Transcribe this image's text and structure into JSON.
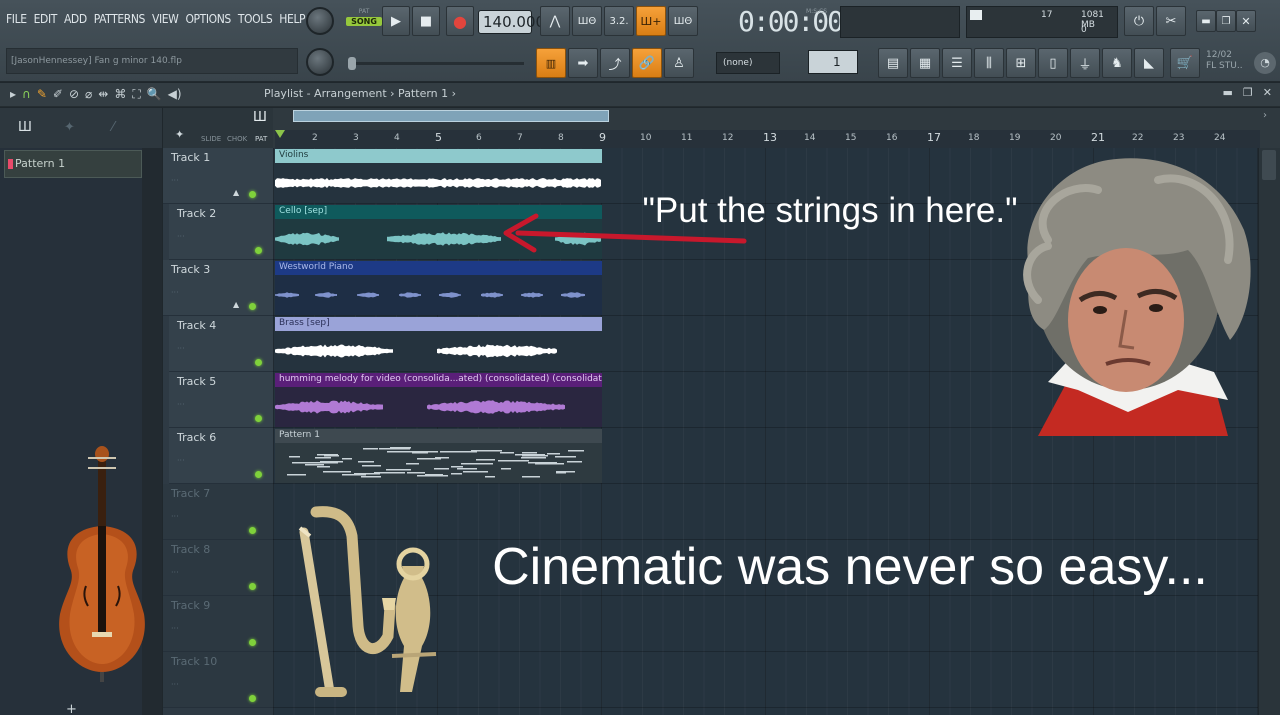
{
  "menu": [
    "FILE",
    "EDIT",
    "ADD",
    "PATTERNS",
    "VIEW",
    "OPTIONS",
    "TOOLS",
    "HELP"
  ],
  "transport": {
    "mode_label_pat": "PAT",
    "mode_label_song": "SONG",
    "tempo": "140.000",
    "time": "0:00:00",
    "time_unit": "M:S:CS"
  },
  "monitor": {
    "cpu_value": "17",
    "memory": "1081 MB",
    "polyphony": "0"
  },
  "project": {
    "filename": "[JasonHennessey] Fan g minor 140.flp"
  },
  "pattern_selector": {
    "value": "(none)",
    "step": "1"
  },
  "fl_news": {
    "date": "12/02",
    "label": "FL STU.."
  },
  "browser_bar": {
    "breadcrumb": "Playlist - Arrangement › Pattern 1 ›"
  },
  "picker": {
    "patterns": [
      "Pattern 1"
    ]
  },
  "ruler": {
    "bars": [
      "2",
      "3",
      "4",
      "5",
      "6",
      "7",
      "8",
      "9",
      "10",
      "11",
      "12",
      "13",
      "14",
      "15",
      "16",
      "17",
      "18",
      "19",
      "20",
      "21",
      "22",
      "23",
      "24"
    ],
    "major_bars": [
      "5",
      "9",
      "13",
      "17",
      "21"
    ]
  },
  "track_tools": {
    "labels": [
      "SLIDE",
      "CHOK",
      "PAT"
    ]
  },
  "tracks": [
    {
      "name": "Track 1"
    },
    {
      "name": "Track 2"
    },
    {
      "name": "Track 3"
    },
    {
      "name": "Track 4"
    },
    {
      "name": "Track 5"
    },
    {
      "name": "Track 6"
    },
    {
      "name": "Track 7"
    },
    {
      "name": "Track 8"
    },
    {
      "name": "Track 9"
    },
    {
      "name": "Track 10"
    }
  ],
  "clips": [
    {
      "label": "Violins",
      "header_color": "#8ec9cc",
      "body_color": "#25333e",
      "wave_color": "#ffffff",
      "text_color": "#1f3b3d"
    },
    {
      "label": "Cello [sep]",
      "header_color": "#0f5a5c",
      "body_color": "#1f3a40",
      "wave_color": "#7bc4c4",
      "text_color": "#9fe1e0"
    },
    {
      "label": "Westworld Piano",
      "header_color": "#1d3a86",
      "body_color": "#1e2e45",
      "wave_color": "#7f92cc",
      "text_color": "#a9b8e8"
    },
    {
      "label": "Brass [sep]",
      "header_color": "#9aa3d8",
      "body_color": "#25333e",
      "wave_color": "#ffffff",
      "text_color": "#2b3058"
    },
    {
      "label": "humming melody for video (consolida...ated) (consolidated) (consolidated)",
      "header_color": "#5a1f79",
      "body_color": "#2a2640",
      "wave_color": "#b07ad4",
      "text_color": "#e0c7f0"
    },
    {
      "label": "Pattern 1",
      "header_color": "#3e4950",
      "body_color": "#2e3a40",
      "wave_color": "#c9d3d8",
      "text_color": "#c9d3d8"
    }
  ],
  "captions": {
    "top": "\"Put the strings in here.\"",
    "bottom": "Cinematic was never so easy..."
  },
  "colors": {
    "accent_orange": "#f08c1f",
    "song_green": "#96c83c",
    "led_green": "#7fd13b",
    "arrow_red": "#c8182c"
  }
}
